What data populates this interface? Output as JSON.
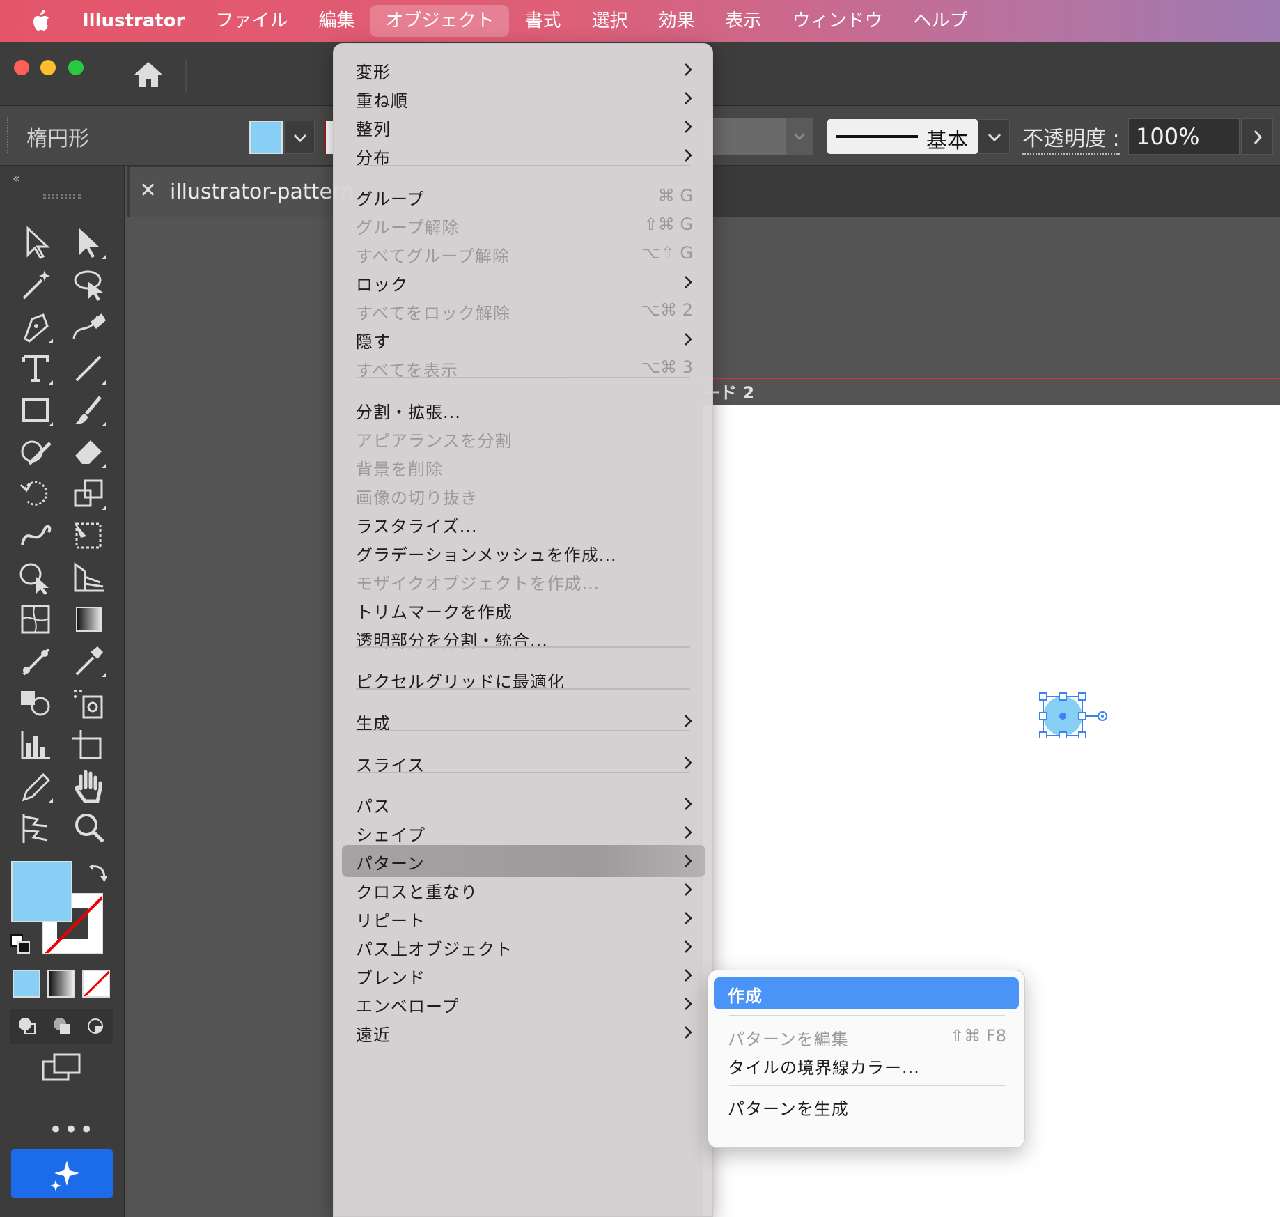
{
  "menubar": {
    "app_name": "Illustrator",
    "items": [
      "ファイル",
      "編集",
      "オブジェクト",
      "書式",
      "選択",
      "効果",
      "表示",
      "ウィンドウ",
      "ヘルプ"
    ],
    "active_item": "オブジェクト"
  },
  "control_bar": {
    "object_type": "楕円形",
    "fill_color": "#88cff5",
    "stroke_profile": "基本",
    "opacity_label": "不透明度 :",
    "opacity_value": "100%"
  },
  "document": {
    "tab_title": "illustrator-pattern",
    "artboard_label": "ード 2"
  },
  "colors": {
    "accent": "#4a93f7",
    "fill": "#88cff5",
    "ai_button": "#1b6bea",
    "artboard_border": "#d83434"
  },
  "object_menu": {
    "items": [
      {
        "label": "変形",
        "submenu": true
      },
      {
        "label": "重ね順",
        "submenu": true
      },
      {
        "label": "整列",
        "submenu": true
      },
      {
        "label": "分布",
        "submenu": true
      },
      {
        "label": "グループ",
        "shortcut": "⌘ G"
      },
      {
        "label": "グループ解除",
        "shortcut": "⇧⌘ G",
        "disabled": true
      },
      {
        "label": "すべてグループ解除",
        "shortcut": "⌥⇧ G",
        "disabled": true
      },
      {
        "label": "ロック",
        "submenu": true
      },
      {
        "label": "すべてをロック解除",
        "shortcut": "⌥⌘ 2",
        "disabled": true
      },
      {
        "label": "隠す",
        "submenu": true
      },
      {
        "label": "すべてを表示",
        "shortcut": "⌥⌘ 3",
        "disabled": true
      },
      {
        "label": "分割・拡張..."
      },
      {
        "label": "アピアランスを分割",
        "disabled": true
      },
      {
        "label": "背景を削除",
        "disabled": true
      },
      {
        "label": "画像の切り抜き",
        "disabled": true
      },
      {
        "label": "ラスタライズ..."
      },
      {
        "label": "グラデーションメッシュを作成..."
      },
      {
        "label": "モザイクオブジェクトを作成...",
        "disabled": true
      },
      {
        "label": "トリムマークを作成"
      },
      {
        "label": "透明部分を分割・統合..."
      },
      {
        "label": "ピクセルグリッドに最適化"
      },
      {
        "label": "生成",
        "submenu": true
      },
      {
        "label": "スライス",
        "submenu": true
      },
      {
        "label": "パス",
        "submenu": true
      },
      {
        "label": "シェイプ",
        "submenu": true
      },
      {
        "label": "パターン",
        "submenu": true,
        "highlighted": true
      },
      {
        "label": "クロスと重なり",
        "submenu": true
      },
      {
        "label": "リピート",
        "submenu": true
      },
      {
        "label": "パス上オブジェクト",
        "submenu": true
      },
      {
        "label": "ブレンド",
        "submenu": true
      },
      {
        "label": "エンベロープ",
        "submenu": true
      },
      {
        "label": "遠近",
        "submenu": true
      }
    ]
  },
  "pattern_submenu": {
    "items": [
      {
        "label": "作成",
        "highlighted": true
      },
      {
        "label": "パターンを編集",
        "shortcut": "⇧⌘ F8",
        "disabled": true
      },
      {
        "label": "タイルの境界線カラー..."
      },
      {
        "label": "パターンを生成"
      }
    ]
  }
}
